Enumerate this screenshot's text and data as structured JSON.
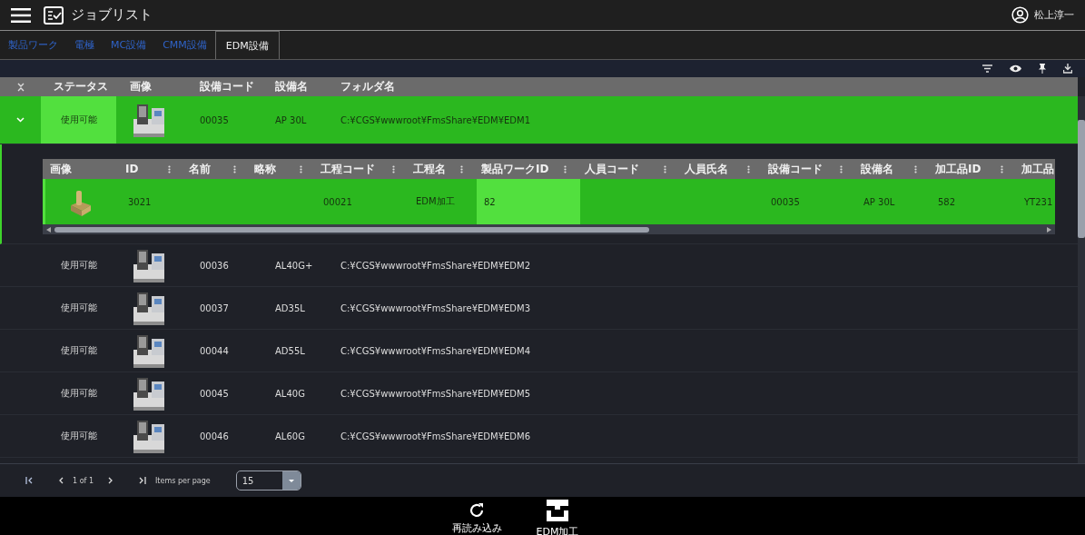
{
  "app_bar": {
    "title": "ジョブリスト",
    "user": "松上淳一"
  },
  "tabs": [
    {
      "label": "製品ワーク",
      "selected": false
    },
    {
      "label": "電極",
      "selected": false
    },
    {
      "label": "MC設備",
      "selected": false
    },
    {
      "label": "CMM設備",
      "selected": false
    },
    {
      "label": "EDM設備",
      "selected": true
    }
  ],
  "table": {
    "columns": [
      "ステータス",
      "画像",
      "設備コード",
      "設備名",
      "フォルダ名"
    ],
    "rows": [
      {
        "selected": true,
        "expanded": true,
        "status": {
          "text": "使用可能",
          "highlighted": true
        },
        "code": "00035",
        "name": "AP 30L",
        "folder": "C:¥CGS¥wwwroot¥FmsShare¥EDM¥EDM1",
        "detail": {
          "columns": [
            "画像",
            "ID",
            "名前",
            "略称",
            "工程コード",
            "工程名",
            "製品ワークID",
            "人員コード",
            "人員氏名",
            "設備コード",
            "設備名",
            "加工品ID",
            "加工品"
          ],
          "cells": [
            {
              "kind": "picture"
            },
            {
              "text": "3021",
              "highlighted": false
            },
            {
              "highlighted": false
            },
            {
              "highlighted": false
            },
            {
              "text": "00021",
              "highlighted": false
            },
            {
              "text": "EDM加工",
              "highlighted": false
            },
            {
              "text": "82",
              "highlighted": true
            },
            {
              "highlighted": false
            },
            {
              "highlighted": false
            },
            {
              "text": "00035",
              "highlighted": false
            },
            {
              "text": "AP 30L",
              "highlighted": false
            },
            {
              "text": "582",
              "highlighted": false
            },
            {
              "text": "YT231",
              "highlighted": false
            }
          ]
        }
      },
      {
        "selected": false,
        "expanded": false,
        "status": {
          "text": "使用可能",
          "highlighted": false
        },
        "code": "00036",
        "name": "AL40G+",
        "folder": "C:¥CGS¥wwwroot¥FmsShare¥EDM¥EDM2"
      },
      {
        "selected": false,
        "expanded": false,
        "status": {
          "text": "使用可能",
          "highlighted": false
        },
        "code": "00037",
        "name": "AD35L",
        "folder": "C:¥CGS¥wwwroot¥FmsShare¥EDM¥EDM3"
      },
      {
        "selected": false,
        "expanded": false,
        "status": {
          "text": "使用可能",
          "highlighted": false
        },
        "code": "00044",
        "name": "AD55L",
        "folder": "C:¥CGS¥wwwroot¥FmsShare¥EDM¥EDM4"
      },
      {
        "selected": false,
        "expanded": false,
        "status": {
          "text": "使用可能",
          "highlighted": false
        },
        "code": "00045",
        "name": "AL40G",
        "folder": "C:¥CGS¥wwwroot¥FmsShare¥EDM¥EDM5"
      },
      {
        "selected": false,
        "expanded": false,
        "status": {
          "text": "使用可能",
          "highlighted": false
        },
        "code": "00046",
        "name": "AL60G",
        "folder": "C:¥CGS¥wwwroot¥FmsShare¥EDM¥EDM6"
      }
    ]
  },
  "pagination": {
    "range": "1 of 1",
    "items_per_page_label": "Items per page",
    "items_per_page": "15"
  },
  "actions": [
    {
      "kind": "reload",
      "label": "再読み込み"
    },
    {
      "kind": "edm",
      "label": "EDM加工"
    }
  ]
}
